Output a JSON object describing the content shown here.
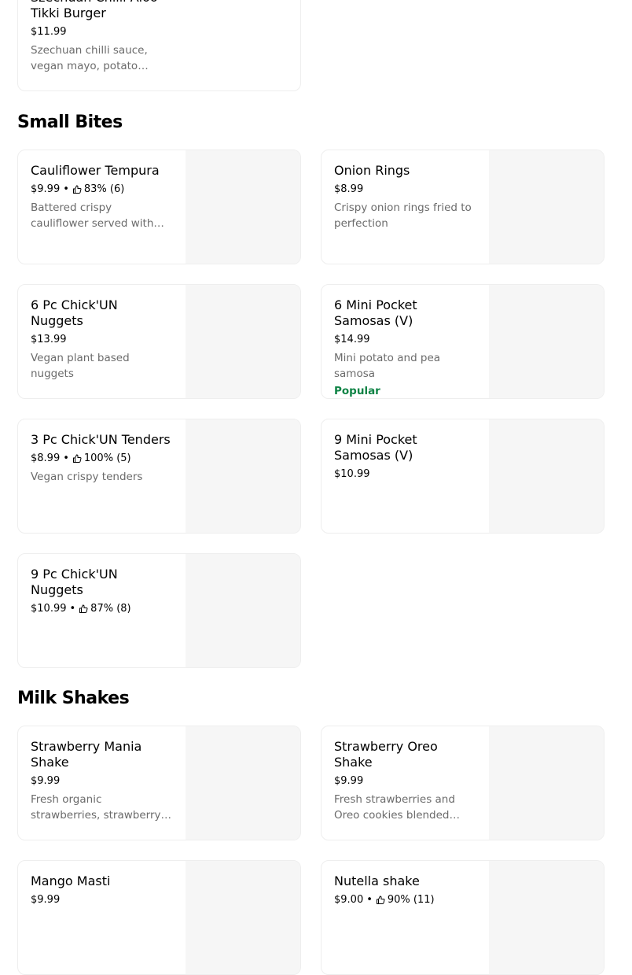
{
  "top_card": {
    "name": "Szechuan Chilli Aloo Tikki Burger",
    "price": "$11.99",
    "description": "Szechuan chilli sauce, vegan mayo, potato patty..."
  },
  "sections": [
    {
      "title": "Small Bites",
      "items": [
        {
          "name": "Cauliflower Tempura",
          "price": "$9.99",
          "rating": "83% (6)",
          "description": "Battered crispy cauliflower served with sweet chilli dip"
        },
        {
          "name": "Onion Rings",
          "price": "$8.99",
          "description": "Crispy onion rings fried to perfection"
        },
        {
          "name": "6 Pc Chick'UN Nuggets",
          "price": "$13.99",
          "description": "Vegan plant based nuggets"
        },
        {
          "name": "6 Mini Pocket Samosas (V)",
          "price": "$14.99",
          "description": "Mini potato and pea samosa",
          "tag": "Popular"
        },
        {
          "name": "3 Pc Chick'UN Tenders",
          "price": "$8.99",
          "rating": "100% (5)",
          "description": "Vegan crispy tenders"
        },
        {
          "name": "9 Mini Pocket Samosas (V)",
          "price": "$10.99"
        },
        {
          "name": "9 Pc Chick'UN Nuggets",
          "price": "$10.99",
          "rating": "87% (8)"
        }
      ]
    },
    {
      "title": "Milk Shakes",
      "items": [
        {
          "name": "Strawberry Mania Shake",
          "price": "$9.99",
          "description": "Fresh organic strawberries, strawberry puree, vanilla..."
        },
        {
          "name": "Strawberry Oreo Shake",
          "price": "$9.99",
          "description": "Fresh strawberries and Oreo cookies blended together t..."
        },
        {
          "name": "Mango Masti",
          "price": "$9.99"
        },
        {
          "name": "Nutella shake",
          "price": "$9.00",
          "rating": "90% (11)"
        }
      ]
    }
  ],
  "colors": {
    "popular": "#0e8345",
    "description": "#6b6b6b",
    "image_placeholder": "#f6f6f6"
  },
  "icons": {
    "rating": "thumbs-up-icon"
  }
}
